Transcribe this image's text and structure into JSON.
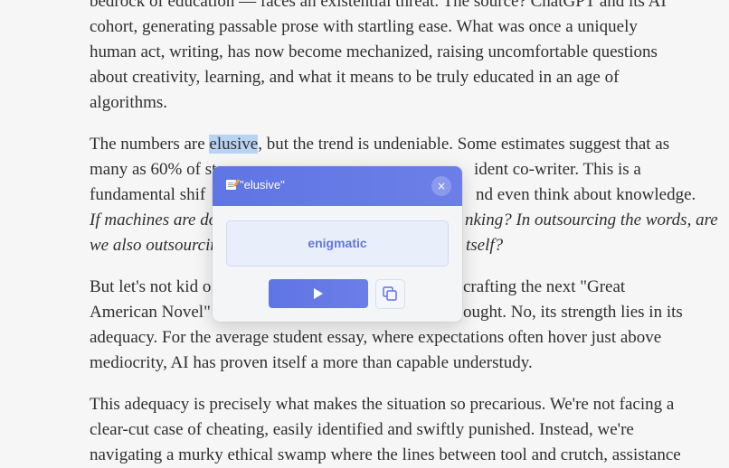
{
  "article": {
    "lines": [
      "bedrock of education — faces an existential threat. The source? ChatGPT and its AI",
      "cohort, generating passable prose with startling ease. What was once a uniquely",
      "human act, writing, has now become mechanized, raising uncomfortable questions",
      "about creativity, learning, and what it means to be truly educated in an age of",
      "algorithms.",
      "The numbers are ",
      "elusive",
      ", but the trend is undeniable. Some estimates suggest that as",
      "many as 60% of st",
      "ident co-writer. This is a",
      "fundamental shif",
      "nd even think about knowledge.",
      "If machines are doi",
      "nking? In outsourcing the words, are",
      "we also outsourcing",
      "tself?",
      "But let's not kid o",
      "crafting the next \"Great",
      "American Novel\"",
      "ought. No, its strength lies in its",
      "adequacy. For the average student essay, where expectations often hover just above",
      "mediocrity, AI has proven itself a more than capable understudy.",
      "This adequacy is precisely what makes the situation so precarious. We're not facing a",
      "clear-cut case of cheating, easily identified and swiftly punished. Instead, we're",
      "navigating a murky ethical swamp where the lines between tool and crutch, assistance"
    ]
  },
  "popup": {
    "title": "\"elusive\"",
    "close_symbol": "×",
    "translation": "enigmatic",
    "icons": {
      "title": "memo-icon",
      "play": "play-icon",
      "copy": "copy-icon",
      "close": "close-icon"
    }
  }
}
